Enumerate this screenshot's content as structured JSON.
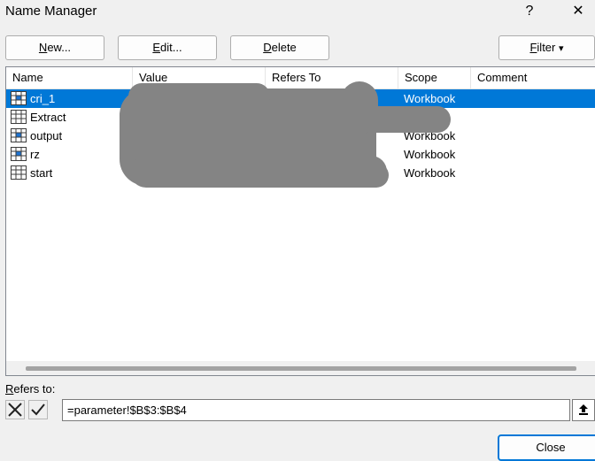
{
  "window": {
    "title": "Name Manager",
    "help_label": "?",
    "close_label": "✕"
  },
  "toolbar": {
    "new_pre": "",
    "new_key": "N",
    "new_post": "ew...",
    "edit_pre": "",
    "edit_key": "E",
    "edit_post": "dit...",
    "delete_pre": "",
    "delete_key": "D",
    "delete_post": "elete",
    "filter_pre": "",
    "filter_key": "F",
    "filter_post": "ilter",
    "filter_arrow": "▾"
  },
  "list": {
    "columns": [
      "Name",
      "Value",
      "Refers To",
      "Scope",
      "Comment"
    ],
    "rows": [
      {
        "name": "cri_1",
        "scope": "Workbook",
        "selected": true
      },
      {
        "name": "Extract",
        "scope": "",
        "selected": false
      },
      {
        "name": "output",
        "scope": "Workbook",
        "selected": false
      },
      {
        "name": "rz",
        "scope": "Workbook",
        "selected": false
      },
      {
        "name": "start",
        "scope": "Workbook",
        "selected": false
      }
    ]
  },
  "refers": {
    "label_key": "R",
    "label_post": "efers to:",
    "value": "=parameter!$B$3:$B$4"
  },
  "footer": {
    "close_label": "Close"
  },
  "colors": {
    "selection": "#0078d7",
    "redaction": "#848484",
    "focus_border": "#0078d7"
  }
}
